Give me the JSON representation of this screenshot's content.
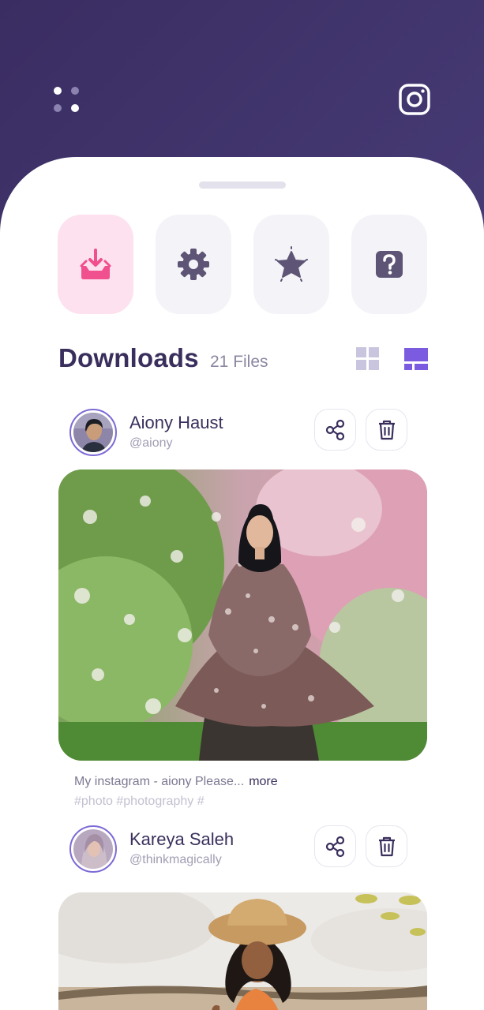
{
  "header": {
    "menu_icon": "grid-dots-icon",
    "instagram_icon": "instagram-icon",
    "background_colors": [
      "#3a2d62",
      "#51467f"
    ]
  },
  "quick_actions": [
    {
      "name": "downloads",
      "icon": "download-tray-icon",
      "active": true,
      "color": "#f0508e"
    },
    {
      "name": "settings",
      "icon": "gear-icon",
      "active": false,
      "color": "#5e5475"
    },
    {
      "name": "favorites",
      "icon": "star-icon",
      "active": false,
      "color": "#5e5475"
    },
    {
      "name": "help",
      "icon": "question-icon",
      "active": false,
      "color": "#5e5475"
    }
  ],
  "downloads": {
    "title": "Downloads",
    "count": "21 Files",
    "view_modes": [
      {
        "icon": "grid-view-icon",
        "active": false
      },
      {
        "icon": "list-view-icon",
        "active": true
      }
    ]
  },
  "posts": [
    {
      "name": "Aiony Haust",
      "handle": "@aiony",
      "caption": "My instagram - aiony Please...",
      "more_label": "more",
      "tags": "#photo #photography #"
    },
    {
      "name": "Kareya Saleh",
      "handle": "@thinkmagically"
    }
  ],
  "colors": {
    "accent": "#7b5ce0",
    "brand_dark": "#3a2f5c",
    "pink": "#f0508e"
  }
}
